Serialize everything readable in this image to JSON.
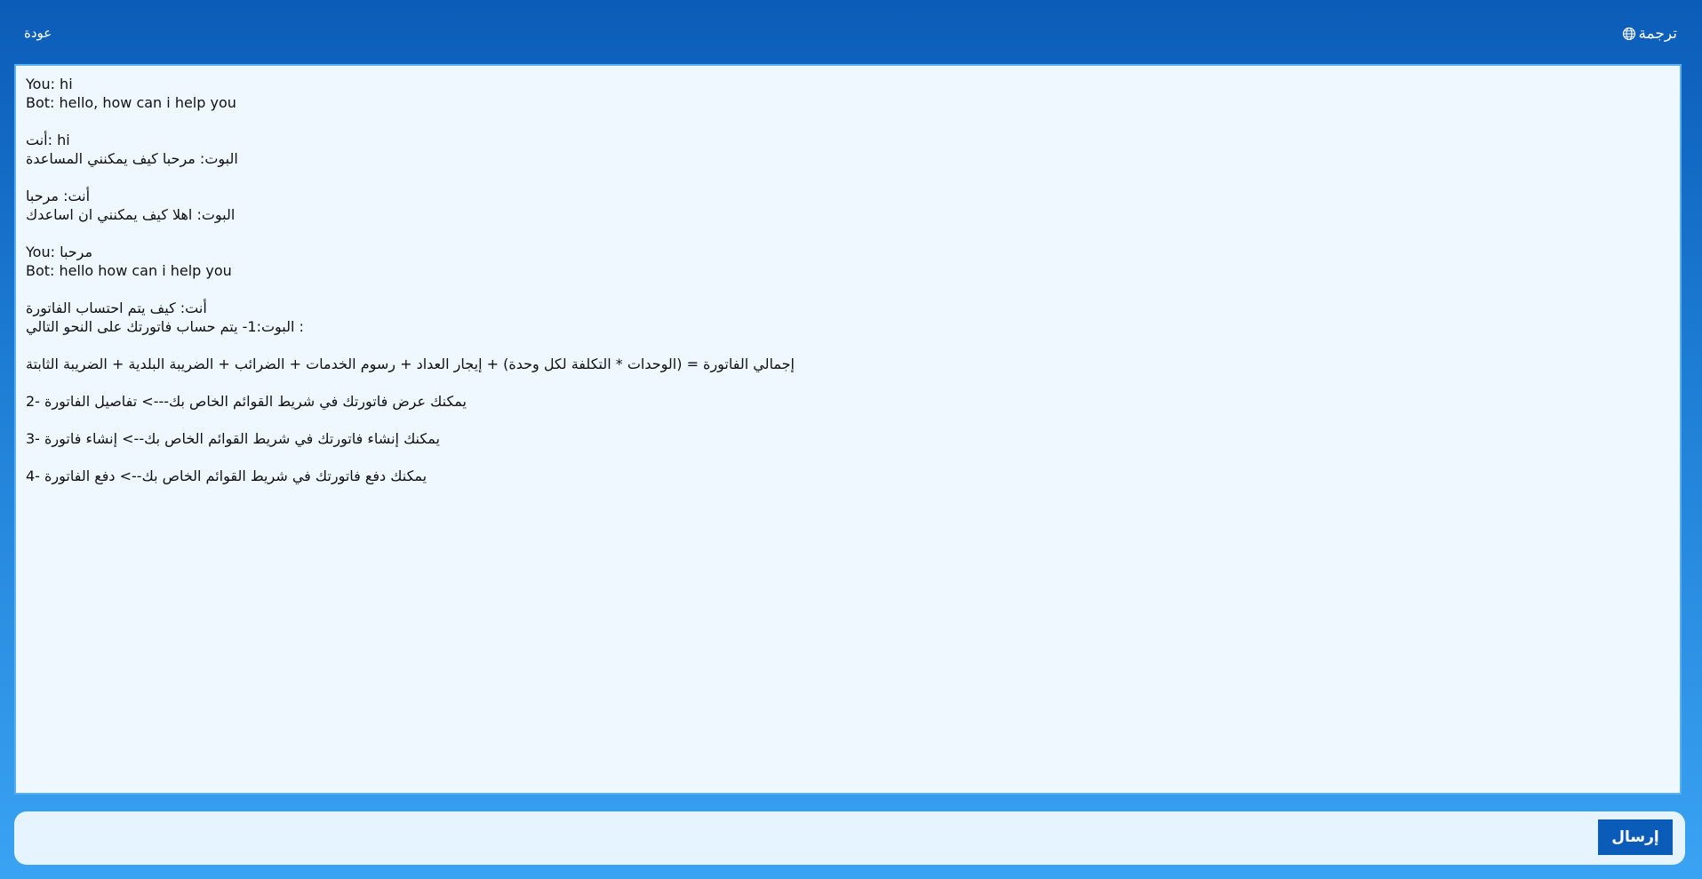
{
  "header": {
    "back_label": "عودة",
    "translate_label": "ترجمة",
    "translate_icon": "globe-icon"
  },
  "chat": {
    "lines": [
      "You: hi",
      "Bot: hello, how can i help you",
      "",
      "أنت: hi",
      "البوت: مرحبا كيف يمكنني المساعدة",
      "",
      "أنت: مرحبا",
      "البوت: اهلا كيف يمكنني ان اساعدك",
      "",
      "You: مرحبا",
      "Bot: hello how can i help you",
      "",
      "أنت: كيف يتم احتساب الفاتورة",
      "البوت:1- يتم حساب فاتورتك على النحو التالي :",
      "",
      "إجمالي الفاتورة = (الوحدات * التكلفة لكل وحدة) + إيجار العداد + رسوم الخدمات + الضرائب + الضريبة البلدية + الضريبة الثابتة",
      "",
      "2- يمكنك عرض فاتورتك في شريط القوائم الخاص بك---> تفاصيل الفاتورة",
      "",
      "3- يمكنك إنشاء فاتورتك في شريط القوائم الخاص بك--> إنشاء فاتورة",
      "",
      "4- يمكنك دفع فاتورتك في شريط القوائم الخاص بك--> دفع الفاتورة"
    ]
  },
  "composer": {
    "placeholder": "",
    "value": "",
    "send_label": "إرسال"
  },
  "colors": {
    "header_blue": "#0b5cb8",
    "background_bottom": "#3aa3f2",
    "chat_background": "#eff8ff",
    "chat_border": "#5ab0ee",
    "send_button": "#0b5cb8"
  }
}
